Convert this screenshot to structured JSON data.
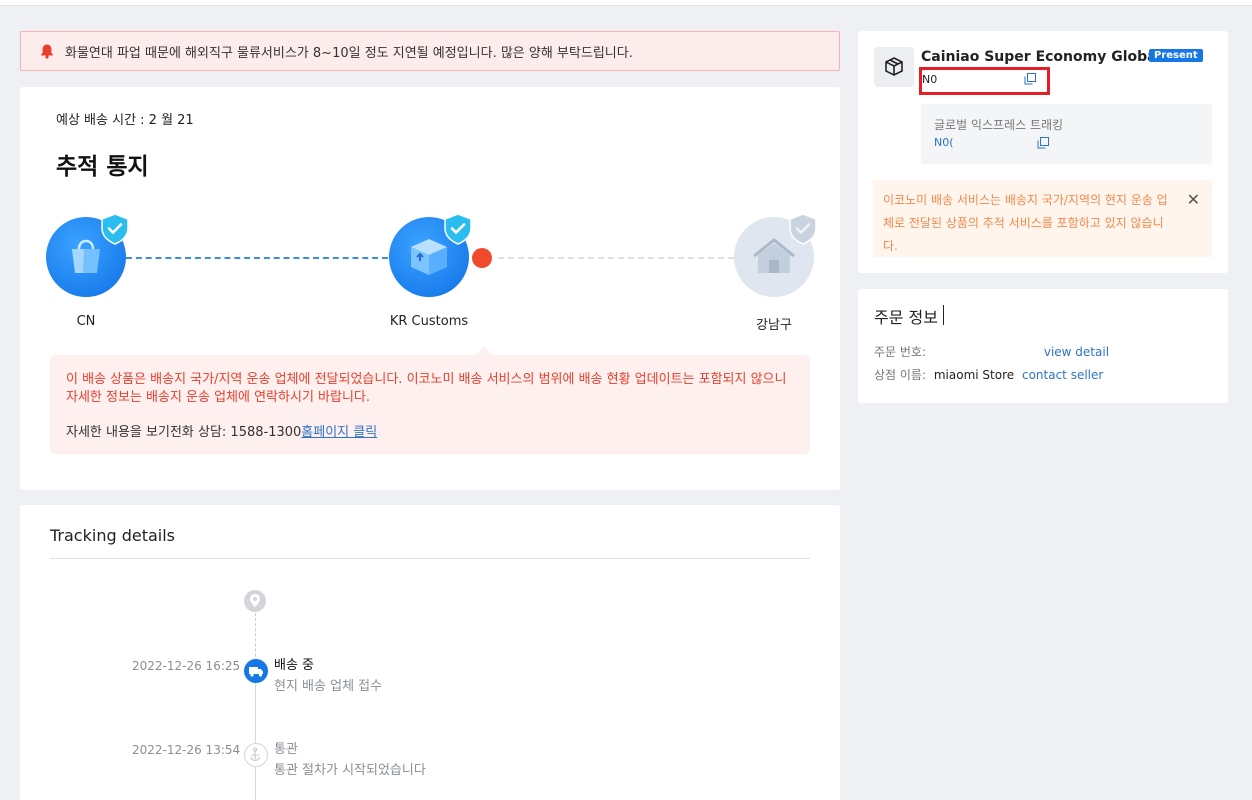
{
  "notice": {
    "text": "화물연대 파업 때문에 해외직구 물류서비스가 8~10일 정도 지연될 예정입니다. 많은 양해 부탁드립니다."
  },
  "status": {
    "eta": "예상 배송 시간 : 2 월 21",
    "title": "추적 통지",
    "steps": [
      {
        "label": "CN",
        "state": "done",
        "icon": "shopping-bag-icon"
      },
      {
        "label": "KR Customs",
        "state": "current",
        "icon": "package-box-icon"
      },
      {
        "label": "강남구",
        "state": "pending",
        "icon": "house-icon"
      }
    ],
    "info": {
      "message": "이 배송 상품은 배송지 국가/지역 운송 업체에 전달되었습니다. 이코노미 배송 서비스의 범위에 배송 현황 업데이트는 포함되지 않으니 자세한 정보는 배송지 운송 업체에 연락하시기 바랍니다.",
      "contact_prefix": "자세한 내용을 보기전화 상담: 1588-1300",
      "contact_link": "홈페이지 클릭"
    }
  },
  "details": {
    "title": "Tracking details",
    "events": [
      {
        "time": "2022-12-26 16:25",
        "status": "배송 중",
        "sub": "현지 배송 업체 접수",
        "icon": "truck-icon",
        "active": true
      },
      {
        "time": "2022-12-26 13:54",
        "status": "통관",
        "sub": "통관 절차가 시작되었습니다",
        "icon": "anchor-icon",
        "active": false
      }
    ]
  },
  "carrier": {
    "name": "Cainiao Super Economy Global",
    "badge": "Present",
    "tracking_no": "N0",
    "global_label": "글로벌 익스프레스 트래킹",
    "global_no": "N0(",
    "warning": "이코노미 배송 서비스는 배송지 국가/지역의 현지 운송 업체로 전달된 상품의 추적 서비스를 포함하고 있지 않습니다.",
    "close": "✕"
  },
  "order": {
    "title": "주문 정보",
    "number_label": "주문 번호:",
    "number_value": "",
    "view_detail": "view detail",
    "store_label": "상점 이름:",
    "store_name": "miaomi Store",
    "contact_seller": "contact seller"
  },
  "colors": {
    "accent": "#1677e6",
    "alert_red": "#e8402c",
    "warning_orange": "#f08a4b"
  }
}
